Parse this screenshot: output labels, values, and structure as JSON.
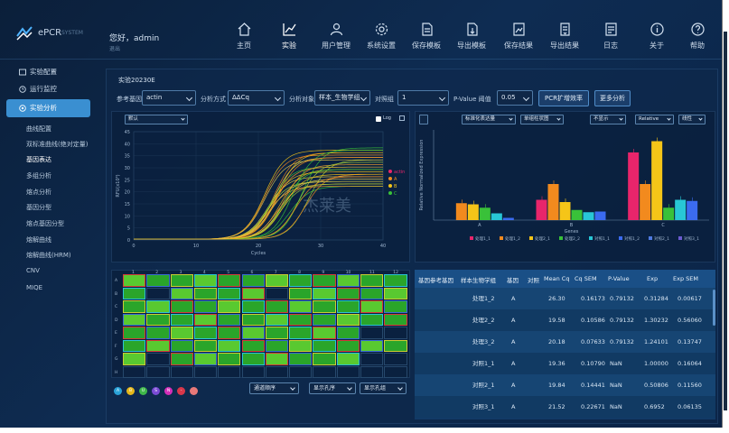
{
  "app": {
    "brand": "ePCR",
    "brand_sub": "SYSTEM",
    "user": "您好，admin",
    "user_sub": "退出"
  },
  "nav": [
    {
      "key": "home",
      "label": "主页"
    },
    {
      "key": "experiment",
      "label": "实验"
    },
    {
      "key": "users",
      "label": "用户管理"
    },
    {
      "key": "settings",
      "label": "系统设置"
    },
    {
      "key": "save-template",
      "label": "保存模板"
    },
    {
      "key": "export-template",
      "label": "导出模板"
    },
    {
      "key": "save-result",
      "label": "保存结果"
    },
    {
      "key": "export-result",
      "label": "导出结果"
    },
    {
      "key": "log",
      "label": "日志"
    },
    {
      "key": "about",
      "label": "关于"
    },
    {
      "key": "help",
      "label": "帮助"
    }
  ],
  "sidebar": {
    "main": [
      {
        "label": "实验配置"
      },
      {
        "label": "运行监控"
      },
      {
        "label": "实验分析"
      }
    ],
    "sub": [
      {
        "label": "曲线配置"
      },
      {
        "label": "双标准曲线(绝对定量)"
      },
      {
        "label": "基因表达"
      },
      {
        "label": "多组分析"
      },
      {
        "label": "熔点分析"
      },
      {
        "label": "基因分型"
      },
      {
        "label": "熔点基因分型"
      },
      {
        "label": "熔解曲线"
      },
      {
        "label": "熔解曲线(HRM)"
      },
      {
        "label": "CNV"
      },
      {
        "label": "MIQE"
      }
    ]
  },
  "experiment": {
    "title": "实验20230E"
  },
  "filters": {
    "ref_gene_label": "参考基因",
    "ref_gene": "actin",
    "method_label": "分析方式",
    "method": "ΔΔCq",
    "target_label": "分析对象",
    "target": "样本_生物学组",
    "control_label": "对照组",
    "control": "1",
    "pvalue_label": "P-Value 阈值",
    "pvalue": "0.05",
    "btn_expand": "PCR扩增效率",
    "btn_more": "更多分析"
  },
  "amp_chart": {
    "dropdown": "默认",
    "log_label": "Log",
    "xlabel": "Cycles",
    "ylabel": "RFU(x10³)",
    "yticks": [
      "45",
      "40",
      "35",
      "30",
      "25",
      "20",
      "15",
      "10",
      "5",
      "0"
    ],
    "xticks": [
      "0",
      "10",
      "20",
      "30",
      "40"
    ],
    "legend": [
      {
        "name": "actin",
        "color": "#e8256b"
      },
      {
        "name": "A",
        "color": "#f28a1e"
      },
      {
        "name": "B",
        "color": "#f5c518"
      },
      {
        "name": "C",
        "color": "#39c139"
      }
    ],
    "watermark": "杰莱美"
  },
  "bar_chart": {
    "dropdowns": [
      "标准化表达量",
      "单组柱状图",
      "不显示",
      "Relative",
      "线性"
    ],
    "ylabel": "Relative Normalized Expression",
    "xlabel": "Genes",
    "legend": [
      "处理1_1",
      "处理1_2",
      "处理2_1",
      "处理2_2",
      "对照1_1",
      "对照1_2",
      "对照2_1",
      "对照3_1"
    ]
  },
  "chart_data": {
    "type": "bar",
    "categories": [
      "A",
      "B",
      "C"
    ],
    "series": [
      {
        "name": "处理1_1",
        "color": "#e8256b",
        "values": [
          0.0,
          0.9,
          3.0
        ]
      },
      {
        "name": "处理1_2",
        "color": "#f28a1e",
        "values": [
          0.75,
          1.6,
          1.6
        ]
      },
      {
        "name": "处理2_1",
        "color": "#f5c518",
        "values": [
          0.7,
          0.8,
          3.5
        ]
      },
      {
        "name": "处理2_2",
        "color": "#39c139",
        "values": [
          0.55,
          0.45,
          0.55
        ]
      },
      {
        "name": "对照1_1",
        "color": "#28c7d6",
        "values": [
          0.3,
          0.35,
          0.9
        ]
      },
      {
        "name": "对照1_2",
        "color": "#3b6bf0",
        "values": [
          0.1,
          0.38,
          0.85
        ]
      }
    ],
    "ylabel": "Relative Normalized Expression",
    "xlabel": "Genes"
  },
  "plate": {
    "cols": [
      "1",
      "2",
      "3",
      "4",
      "5",
      "6",
      "7",
      "8",
      "9",
      "10",
      "11",
      "12"
    ],
    "rows": [
      "A",
      "B",
      "C",
      "D",
      "E",
      "F",
      "G",
      "H"
    ]
  },
  "table": {
    "headers": [
      "基因参考基因",
      "样本生物学组",
      "基因",
      "对照",
      "Mean Cq",
      "Cq SEM",
      "P-Value",
      "Exp",
      "Exp SEM"
    ],
    "rows": [
      [
        "处理1_2",
        "A",
        "",
        "26.30",
        "0.16173",
        "0.79132",
        "0.31284",
        "0.00617"
      ],
      [
        "处理2_2",
        "A",
        "",
        "19.58",
        "0.10586",
        "0.79132",
        "1.30232",
        "0.56060"
      ],
      [
        "处理3_2",
        "A",
        "",
        "20.18",
        "0.07633",
        "0.79132",
        "1.24101",
        "0.13747"
      ],
      [
        "对照1_1",
        "A",
        "",
        "19.36",
        "0.10790",
        "NaN",
        "1.00000",
        "0.16064"
      ],
      [
        "对照2_1",
        "A",
        "",
        "19.84",
        "0.14441",
        "NaN",
        "0.50806",
        "0.11560"
      ],
      [
        "对照3_1",
        "A",
        "",
        "21.52",
        "0.22671",
        "NaN",
        "0.6952",
        "0.06135"
      ]
    ]
  },
  "bottom": {
    "dots": [
      {
        "t": "A",
        "c": "#2aa3d8"
      },
      {
        "t": "B",
        "c": "#e6b81a"
      },
      {
        "t": "U",
        "c": "#3fb84a"
      },
      {
        "t": "S",
        "c": "#7a4bd4"
      },
      {
        "t": "N",
        "c": "#d42fb8"
      },
      {
        "t": "-",
        "c": "#d8374a"
      },
      {
        "t": "",
        "c": "#e87979"
      }
    ],
    "sel1": "通道顺序",
    "sel2": "显示孔序",
    "sel3": "显示孔组"
  }
}
